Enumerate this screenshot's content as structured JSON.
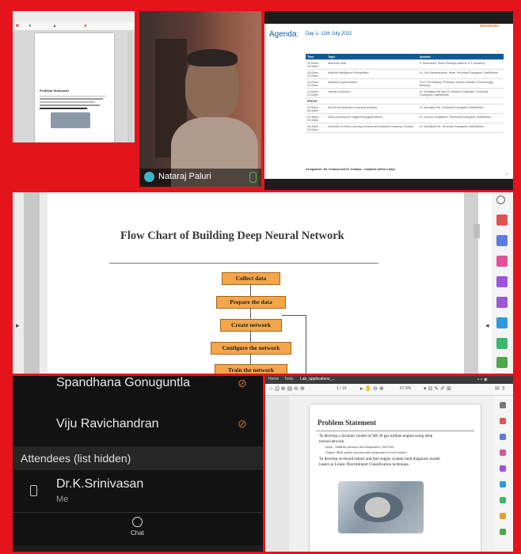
{
  "tile_presenter_thumb": {
    "slide_title": "Problem Statement"
  },
  "tile_participant": {
    "name": "Nataraj Paluri"
  },
  "agenda": {
    "title": "Agenda:",
    "subtitle": "Day 1- 12th July 2021",
    "brand": "MathWorks",
    "columns": [
      "Time",
      "Topic",
      "Speaker"
    ],
    "rows": [
      {
        "time": "10:00am - 10:05am",
        "topic": "Welcome Note",
        "speaker": "K Saravanan, Head Strategic Alliance ICT Academy"
      },
      {
        "time": "10:05am - 10:20am",
        "topic": "Artificial Intelligence Demystified",
        "speaker": "Dr. Viju Ravichandran, Head Technical Evangelist, MathWorks"
      },
      {
        "time": "10:20am - 11:00am",
        "topic": "Academic guest lecture",
        "speaker": "Prof. P.M Nataraj, Professor, Indian Institute of Technology Bombay"
      },
      {
        "time": "11:00am - 12:00pm",
        "topic": "Hands-on session",
        "speaker": "Dr. Monalisa Pal and Dr. Sourish Chatterjee, Technical Evangelist, MathWorks"
      },
      {
        "time": "BREAK",
        "topic": "",
        "speaker": ""
      },
      {
        "time": "02:00pm - 02:45pm",
        "topic": "End-to-end Machine Learning workflow",
        "speaker": "Dr. Monalisa Pal, Technical Evangelist, MathWorks"
      },
      {
        "time": "02:45pm - 03:30pm",
        "topic": "Deep Learning for engineering applications",
        "speaker": "Dr. Sourish Chatterjee, Technical Evangelist, MathWorks"
      },
      {
        "time": "03:30pm - 04:00pm",
        "topic": "Overview of Deep Learning Onramp and Machine Learning Onramp",
        "speaker": "Dr. Monalisa Pal, Technical Evangelist, MathWorks"
      }
    ],
    "footer": "Assignment: ML Onramp and DL Onramp - complete within 3 days",
    "page_number": "2"
  },
  "main_slide": {
    "title": "Flow Chart of Building Deep Neural Network",
    "steps": [
      "Collect data",
      "Prepare the data",
      "Create network",
      "Configure the network",
      "Train the network"
    ]
  },
  "attendees_panel": {
    "names": [
      "Spandhana Gonuguntla",
      "Viju Ravichandran"
    ],
    "section_header": "Attendees (list hidden)",
    "me_name": "Dr.K.Srinivasan",
    "me_label": "Me",
    "chat_label": "Chat"
  },
  "pdf_viewer": {
    "tabs": [
      "Home",
      "Tools",
      "Lab_applications_..."
    ],
    "zoom": "57.9%",
    "page_indicator": "1 / 10",
    "slide_title": "Problem Statement",
    "bullet1": "To develop a dynamic model of SB-30 gas turbine engine using deep neural network.",
    "sub1": "Input : Ambient pressure and temperature, fuel flow",
    "sub2": "Output: Shaft speed, pressure and temperature at each station",
    "bullet2": "To develop on-board sensor and fuel supply system fault diagnosis model based on Linear Discriminant Classification technique."
  },
  "colors": {
    "frame": "#e3141b",
    "flow_box": "#f3a64a",
    "agenda_header": "#0a5a9c",
    "mic_off": "#d86a2b"
  }
}
